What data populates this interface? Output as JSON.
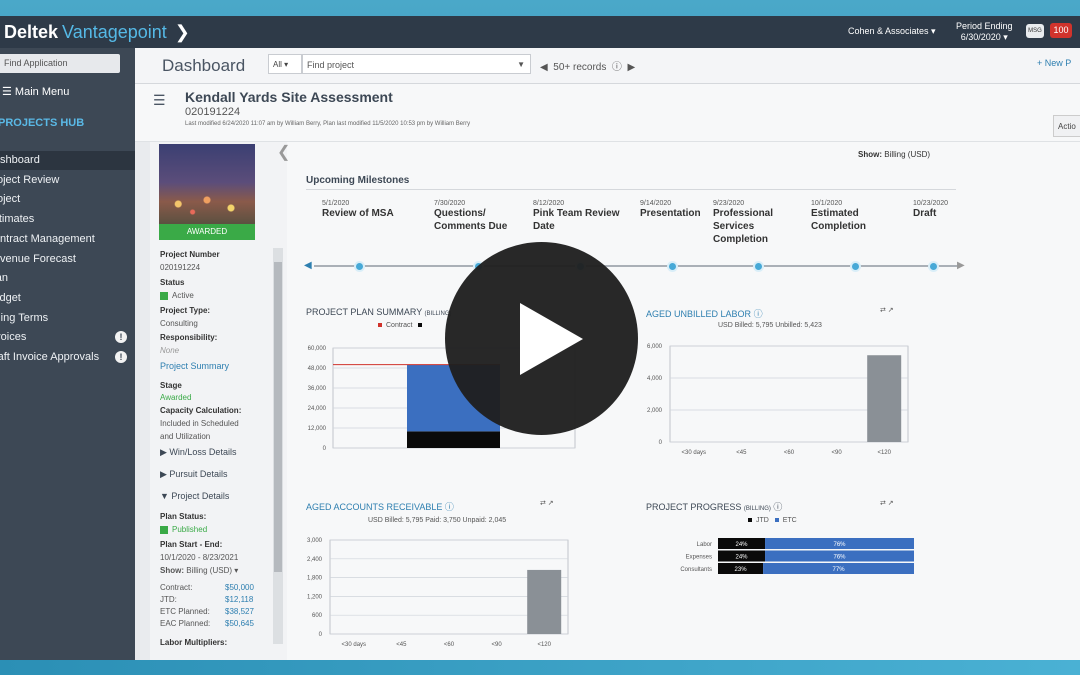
{
  "topbar": {
    "brand": "Deltek",
    "product": "Vantagepoint",
    "company": "Cohen & Associates ▾",
    "period_label": "Period Ending",
    "period_value": "6/30/2020 ▾",
    "msg_badge": "MSG",
    "notif_count": "100"
  },
  "sidebar": {
    "search_placeholder": "Find Application",
    "main_menu": "☰ Main Menu",
    "hub_title": "PROJECTS HUB",
    "items": [
      {
        "label": "Dashboard",
        "active": true
      },
      {
        "label": "Project Review"
      },
      {
        "label": "Project"
      },
      {
        "label": "Estimates"
      },
      {
        "label": "Contract Management"
      },
      {
        "label": "Revenue Forecast"
      },
      {
        "label": "Plan"
      },
      {
        "label": "Budget"
      },
      {
        "label": "Billing Terms"
      },
      {
        "label": "Invoices",
        "alert": true
      },
      {
        "label": "Draft Invoice Approvals",
        "alert": true
      }
    ]
  },
  "header": {
    "title": "Dashboard",
    "filter": "All ▾",
    "find_placeholder": "Find project",
    "records": "50+ records",
    "new": "+ New P"
  },
  "project": {
    "name": "Kendall Yards Site Assessment",
    "number": "020191224",
    "modified": "Last modified 6/24/2020 11:07 am by William Berry, Plan last modified 11/5/2020 10:53 pm by William Berry",
    "actions": "Actio"
  },
  "info": {
    "awarded": "AWARDED",
    "project_number_label": "Project Number",
    "project_number": "020191224",
    "status_label": "Status",
    "status": "Active",
    "type_label": "Project Type:",
    "type": "Consulting",
    "resp_label": "Responsibility:",
    "resp": "None",
    "summary_link": "Project Summary",
    "stage_label": "Stage",
    "stage": "Awarded",
    "capacity_label": "Capacity Calculation:",
    "capacity": "Included in Scheduled",
    "capacity2": "and Utilization",
    "winloss": "▶  Win/Loss Details",
    "pursuit": "▶  Pursuit Details",
    "projdetails": "▼  Project Details",
    "plan_status_label": "Plan Status:",
    "plan_status": "Published",
    "plan_dates_label": "Plan Start - End:",
    "plan_dates": "10/1/2020 - 8/23/2021",
    "show_label": "Show:",
    "show_value": "Billing (USD) ▾",
    "contract_label": "Contract:",
    "contract": "$50,000",
    "jtd_label": "JTD:",
    "jtd": "$12,118",
    "etc_label": "ETC Planned:",
    "etc": "$38,527",
    "eac_label": "EAC Planned:",
    "eac": "$50,645",
    "multipliers_label": "Labor Multipliers:"
  },
  "main": {
    "show_label": "Show:",
    "show_value": "Billing (USD)",
    "milestones_title": "Upcoming Milestones",
    "milestones": [
      {
        "date": "5/1/2020",
        "name": "Review of MSA"
      },
      {
        "date": "7/30/2020",
        "name": "Questions/ Comments Due"
      },
      {
        "date": "8/12/2020",
        "name": "Pink Team Review Date"
      },
      {
        "date": "9/14/2020",
        "name": "Presentation"
      },
      {
        "date": "9/23/2020",
        "name": "Professional Services Completion"
      },
      {
        "date": "10/1/2020",
        "name": "Estimated Completion"
      },
      {
        "date": "10/23/2020",
        "name": "Draft"
      }
    ]
  },
  "colors": {
    "accent": "#2e7fb0",
    "green": "#3aaa47",
    "bar_blue": "#3b6fc0",
    "bar_black": "#0a0a0a",
    "bar_gray": "#8a9096",
    "contract_red": "#d0332c"
  },
  "chart_data": [
    {
      "type": "bar",
      "title": "PROJECT PLAN SUMMARY",
      "title_suffix": "(BILLING)",
      "legend": [
        "Contract"
      ],
      "categories": [
        ""
      ],
      "ylim": [
        0,
        60000
      ],
      "yticks": [
        "60,000",
        "48,000",
        "36,000",
        "24,000",
        "12,000",
        "0"
      ],
      "contract": 50000,
      "series": [
        {
          "name": "Contract",
          "values": [
            0
          ]
        },
        {
          "values": [
            10000
          ]
        },
        {
          "values": [
            40000
          ]
        }
      ]
    },
    {
      "type": "bar",
      "title": "AGED UNBILLED LABOR",
      "subtitle": "USD   Billed: 5,795   Unbilled: 5,423",
      "categories": [
        "<30 days",
        "<45",
        "<60",
        "<90",
        "<120"
      ],
      "values": [
        0,
        0,
        0,
        0,
        5423
      ],
      "ylim": [
        0,
        6000
      ],
      "yticks": [
        "6,000",
        "4,000",
        "2,000",
        "0"
      ]
    },
    {
      "type": "bar",
      "title": "AGED ACCOUNTS RECEIVABLE",
      "subtitle": "USD   Billed: 5,795   Paid: 3,750   Unpaid: 2,045",
      "categories": [
        "<30 days",
        "<45",
        "<60",
        "<90",
        "<120"
      ],
      "values": [
        0,
        0,
        0,
        0,
        2045
      ],
      "ylim": [
        0,
        3000
      ],
      "yticks": [
        "3,000",
        "2,400",
        "1,800",
        "1,200",
        "600",
        "0"
      ]
    },
    {
      "type": "bar",
      "title": "PROJECT PROGRESS",
      "title_suffix": "(BILLING)",
      "legend": [
        "JTD",
        "ETC"
      ],
      "categories": [
        "Labor",
        "Expenses",
        "Consultants"
      ],
      "series": [
        {
          "name": "JTD",
          "values": [
            24,
            24,
            23
          ]
        },
        {
          "name": "ETC",
          "values": [
            76,
            76,
            77
          ]
        }
      ],
      "labels": [
        [
          "24%",
          "76%"
        ],
        [
          "24%",
          "76%"
        ],
        [
          "23%",
          "77%"
        ]
      ]
    }
  ],
  "play_icon": "play-button"
}
